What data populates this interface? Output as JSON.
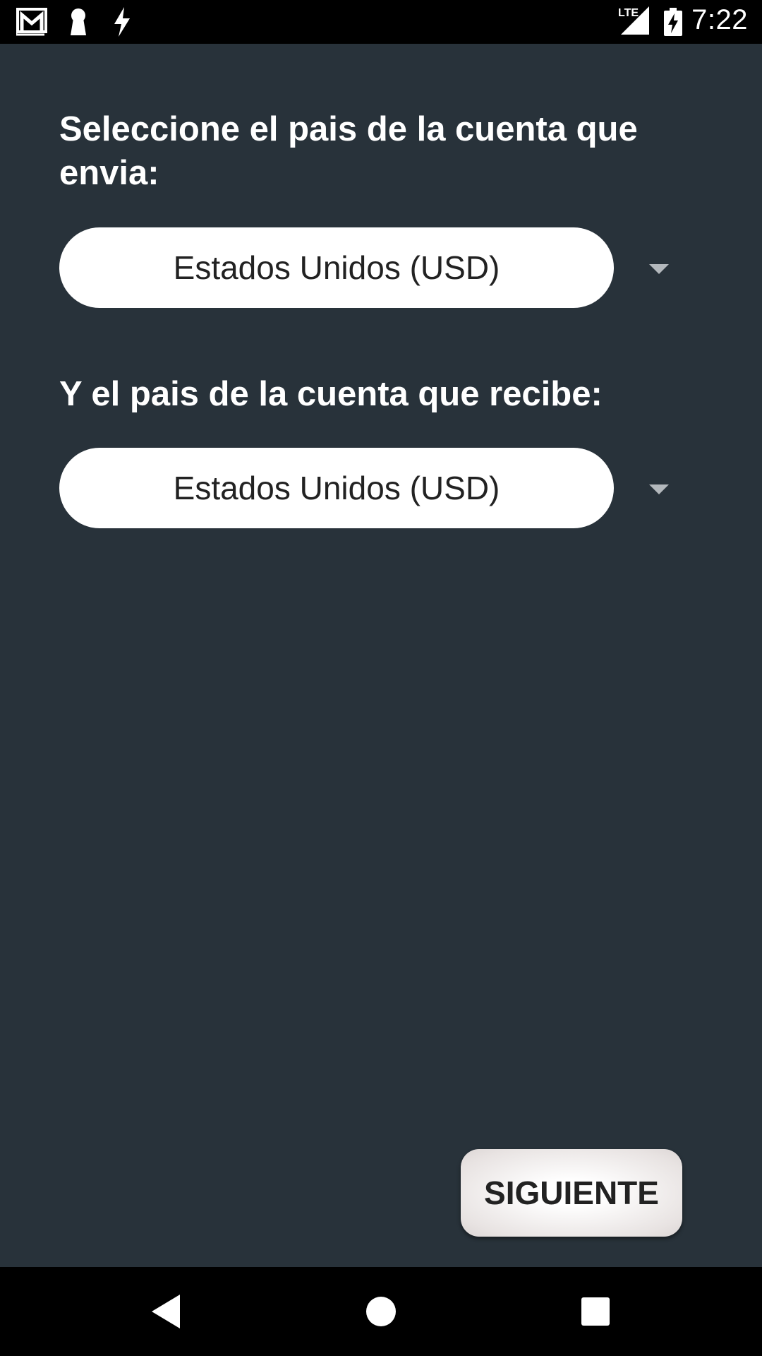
{
  "status_bar": {
    "time": "7:22",
    "network_label": "LTE",
    "icons": [
      "gmail-icon",
      "keyhole-icon",
      "flash-icon",
      "signal-icon",
      "battery-charging-icon"
    ]
  },
  "form": {
    "send_label": "Seleccione el pais de la cuenta que envia:",
    "send_value": "Estados Unidos (USD)",
    "receive_label": "Y el pais de la cuenta que recibe:",
    "receive_value": "Estados Unidos (USD)"
  },
  "actions": {
    "next_label": "SIGUIENTE"
  },
  "nav": {
    "icons": [
      "back-icon",
      "home-icon",
      "recents-icon"
    ]
  },
  "colors": {
    "background": "#28323a",
    "spinner_bg": "#ffffff",
    "caret": "#b3b8bc"
  }
}
